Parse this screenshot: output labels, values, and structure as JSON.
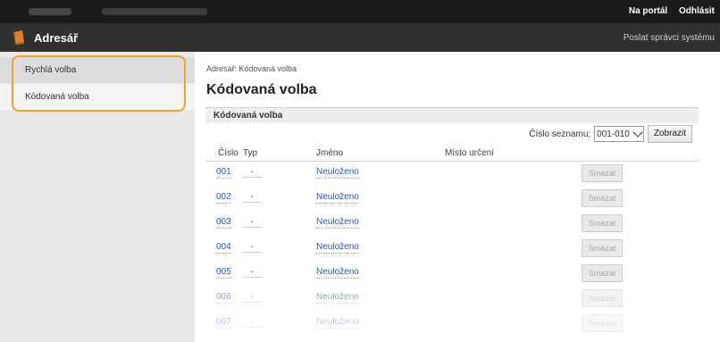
{
  "topbar": {
    "link_portal": "Na portál",
    "link_logout": "Odhlásit"
  },
  "titlebar": {
    "title": "Adresář",
    "right_text": "Poslat správci systému"
  },
  "sidebar": {
    "items": [
      {
        "label": "Rychlá volba"
      },
      {
        "label": "Kódovaná volba"
      }
    ]
  },
  "main": {
    "breadcrumb": "Adresář: Kódovaná volba",
    "title": "Kódovaná volba",
    "section_title": "Kódovaná volba",
    "list_label": "Číslo seznamu:",
    "list_value": "001-010",
    "show_button": "Zobrazit",
    "columns": {
      "number": "Číslo",
      "type": "Typ",
      "name": "Jméno",
      "destination": "Místo určení"
    },
    "rows": [
      {
        "number": "001",
        "type": "-",
        "name": "Neuloženo",
        "delete": "Smazat"
      },
      {
        "number": "002",
        "type": "-",
        "name": "Neuloženo",
        "delete": "Smazat"
      },
      {
        "number": "003",
        "type": "-",
        "name": "Neuloženo",
        "delete": "Smazat"
      },
      {
        "number": "004",
        "type": "-",
        "name": "Neuloženo",
        "delete": "Smazat"
      },
      {
        "number": "005",
        "type": "-",
        "name": "Neuloženo",
        "delete": "Smazat"
      },
      {
        "number": "006",
        "type": "-",
        "name": "Neuloženo",
        "delete": "Smazat"
      },
      {
        "number": "007",
        "type": "-",
        "name": "Neuloženo",
        "delete": "Smazat"
      }
    ]
  }
}
